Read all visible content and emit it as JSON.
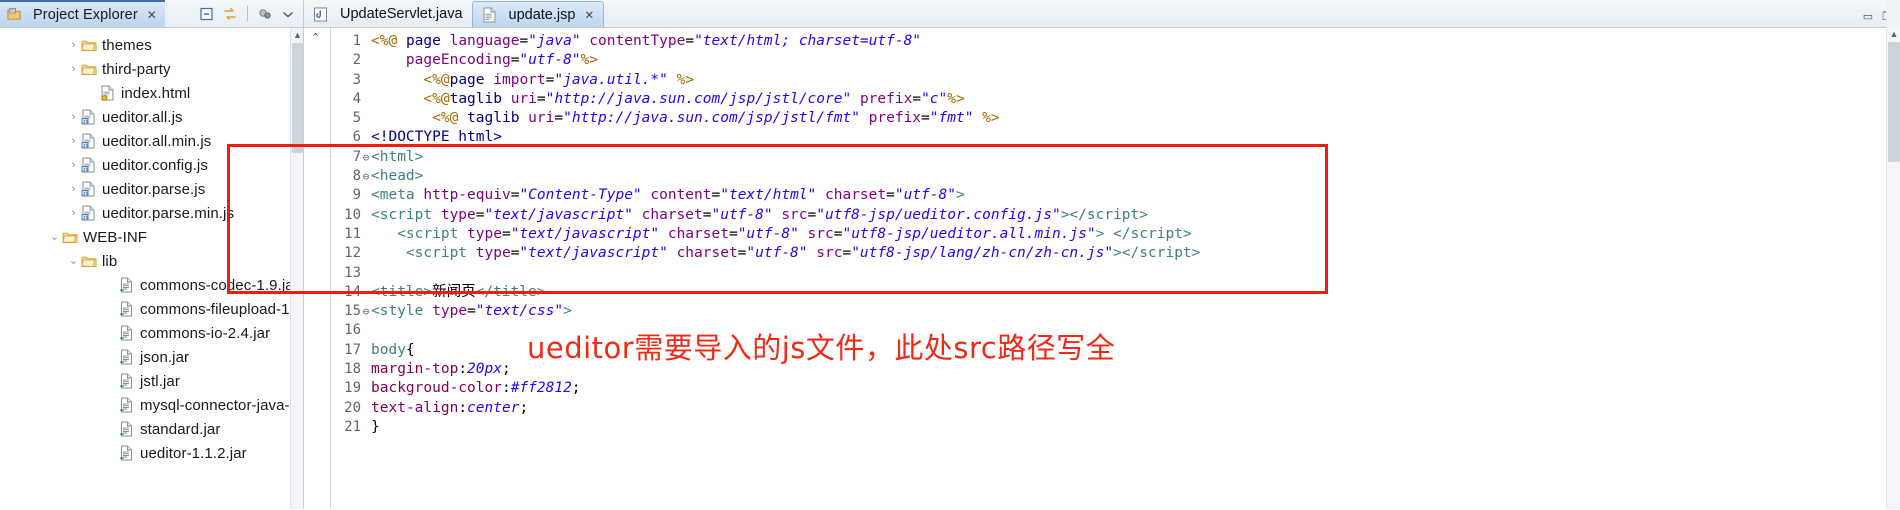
{
  "explorer": {
    "tab_title": "Project Explorer",
    "close_glyph": "✕",
    "toolbar": [
      {
        "name": "collapse-all-icon",
        "glyph": "▣"
      },
      {
        "name": "link-with-editor-icon",
        "glyph": "⇆"
      },
      {
        "name": "focus-on-active-task-icon",
        "glyph": "◕"
      },
      {
        "name": "view-menu-icon",
        "glyph": "▽"
      }
    ],
    "tree": [
      {
        "arrow": "›",
        "icon": "folder-icon",
        "label": "themes",
        "indent": 1
      },
      {
        "arrow": "›",
        "icon": "folder-icon",
        "label": "third-party",
        "indent": 1
      },
      {
        "arrow": "",
        "icon": "html-file-icon",
        "label": "index.html",
        "indent": 2
      },
      {
        "arrow": "›",
        "icon": "js-file-icon",
        "label": "ueditor.all.js",
        "indent": 1
      },
      {
        "arrow": "›",
        "icon": "js-file-icon",
        "label": "ueditor.all.min.js",
        "indent": 1
      },
      {
        "arrow": "›",
        "icon": "js-file-icon",
        "label": "ueditor.config.js",
        "indent": 1
      },
      {
        "arrow": "›",
        "icon": "js-file-icon",
        "label": "ueditor.parse.js",
        "indent": 1
      },
      {
        "arrow": "›",
        "icon": "js-file-icon",
        "label": "ueditor.parse.min.js",
        "indent": 1
      },
      {
        "arrow": "⌄",
        "icon": "folder-icon",
        "label": "WEB-INF",
        "indent": 0
      },
      {
        "arrow": "⌄",
        "icon": "folder-icon",
        "label": "lib",
        "indent": 1
      },
      {
        "arrow": "",
        "icon": "jar-file-icon",
        "label": "commons-codec-1.9.ja",
        "indent": 3
      },
      {
        "arrow": "",
        "icon": "jar-file-icon",
        "label": "commons-fileupload-1",
        "indent": 3
      },
      {
        "arrow": "",
        "icon": "jar-file-icon",
        "label": "commons-io-2.4.jar",
        "indent": 3
      },
      {
        "arrow": "",
        "icon": "jar-file-icon",
        "label": "json.jar",
        "indent": 3
      },
      {
        "arrow": "",
        "icon": "jar-file-icon",
        "label": "jstl.jar",
        "indent": 3
      },
      {
        "arrow": "",
        "icon": "jar-file-icon",
        "label": "mysql-connector-java-",
        "indent": 3
      },
      {
        "arrow": "",
        "icon": "jar-file-icon",
        "label": "standard.jar",
        "indent": 3
      },
      {
        "arrow": "",
        "icon": "jar-file-icon",
        "label": "ueditor-1.1.2.jar",
        "indent": 3
      }
    ]
  },
  "editor": {
    "tabs": [
      {
        "label": "UpdateServlet.java",
        "icon": "java-file-icon",
        "active": false,
        "closable": false
      },
      {
        "label": "update.jsp",
        "icon": "jsp-file-icon",
        "active": true,
        "closable": true
      }
    ],
    "close_glyph": "✕",
    "window_controls": [
      {
        "name": "minimize-view-icon",
        "glyph": "▭"
      },
      {
        "name": "maximize-view-icon",
        "glyph": "❐"
      }
    ],
    "explorer_window_controls": [
      {
        "name": "minimize-explorer-icon",
        "glyph": "▭"
      },
      {
        "name": "maximize-explorer-icon",
        "glyph": "❐"
      }
    ],
    "scroll_up_glyph": "⌃",
    "lines": [
      {
        "n": 1,
        "fold": "",
        "html": "<span class=\"s-dir\">&lt;%@</span> <span class=\"s-tagk\">page</span> <span class=\"s-attr\">language</span><span class=\"s-plain\">=</span><span class=\"s-str\">\"java\"</span> <span class=\"s-attr\">contentType</span><span class=\"s-plain\">=</span><span class=\"s-str\">\"text/html; charset=utf-8\"</span>"
      },
      {
        "n": 2,
        "fold": "",
        "html": "    <span class=\"s-attr\">pageEncoding</span><span class=\"s-plain\">=</span><span class=\"s-str\">\"utf-8\"</span><span class=\"s-dir\">%&gt;</span>"
      },
      {
        "n": 3,
        "fold": "",
        "html": "      <span class=\"s-dir\">&lt;%@</span><span class=\"s-tagk\">page</span> <span class=\"s-attr\">import</span><span class=\"s-plain\">=</span><span class=\"s-str\">\"java.util.*\"</span> <span class=\"s-dir\">%&gt;</span>"
      },
      {
        "n": 4,
        "fold": "",
        "html": "      <span class=\"s-dir\">&lt;%@</span><span class=\"s-tagk\">taglib</span> <span class=\"s-attr\">uri</span><span class=\"s-plain\">=</span><span class=\"s-str\">\"http://java.sun.com/jsp/jstl/core\"</span> <span class=\"s-attr\">prefix</span><span class=\"s-plain\">=</span><span class=\"s-str\">\"c\"</span><span class=\"s-dir\">%&gt;</span>"
      },
      {
        "n": 5,
        "fold": "",
        "html": "       <span class=\"s-dir\">&lt;%@</span> <span class=\"s-tagk\">taglib</span> <span class=\"s-attr\">uri</span><span class=\"s-plain\">=</span><span class=\"s-str\">\"http://java.sun.com/jsp/jstl/fmt\"</span> <span class=\"s-attr\">prefix</span><span class=\"s-plain\">=</span><span class=\"s-str\">\"fmt\"</span> <span class=\"s-dir\">%&gt;</span>"
      },
      {
        "n": 6,
        "fold": "",
        "html": "<span class=\"s-doctype\">&lt;!DOCTYPE html&gt;</span>"
      },
      {
        "n": 7,
        "fold": "⊖",
        "html": "<span class=\"s-tag\">&lt;html&gt;</span>"
      },
      {
        "n": 8,
        "fold": "⊖",
        "html": "<span class=\"s-tag\">&lt;head&gt;</span>"
      },
      {
        "n": 9,
        "fold": "",
        "html": "<span class=\"s-tag\">&lt;meta</span> <span class=\"s-attr\">http-equiv</span><span class=\"s-plain\">=</span><span class=\"s-str\">\"Content-Type\"</span> <span class=\"s-attr\">content</span><span class=\"s-plain\">=</span><span class=\"s-str\">\"text/html\"</span> <span class=\"s-attr\">charset</span><span class=\"s-plain\">=</span><span class=\"s-str\">\"utf-8\"</span><span class=\"s-tag\">&gt;</span>"
      },
      {
        "n": 10,
        "fold": "",
        "html": "<span class=\"s-tag\">&lt;script</span> <span class=\"s-attr\">type</span><span class=\"s-plain\">=</span><span class=\"s-str\">\"text/javascript\"</span> <span class=\"s-attr\">charset</span><span class=\"s-plain\">=</span><span class=\"s-str\">\"utf-8\"</span> <span class=\"s-attr\">src</span><span class=\"s-plain\">=</span><span class=\"s-str\">\"utf8-jsp/ueditor.config.js\"</span><span class=\"s-tag\">&gt;&lt;/script&gt;</span>"
      },
      {
        "n": 11,
        "fold": "",
        "html": "   <span class=\"s-tag\">&lt;script</span> <span class=\"s-attr\">type</span><span class=\"s-plain\">=</span><span class=\"s-str\">\"text/javascript\"</span> <span class=\"s-attr\">charset</span><span class=\"s-plain\">=</span><span class=\"s-str\">\"utf-8\"</span> <span class=\"s-attr\">src</span><span class=\"s-plain\">=</span><span class=\"s-str\">\"utf8-jsp/ueditor.all.min.js\"</span><span class=\"s-tag\">&gt;</span> <span class=\"s-tag\">&lt;/script&gt;</span>"
      },
      {
        "n": 12,
        "fold": "",
        "html": "    <span class=\"s-tag\">&lt;script</span> <span class=\"s-attr\">type</span><span class=\"s-plain\">=</span><span class=\"s-str\">\"text/javascript\"</span> <span class=\"s-attr\">charset</span><span class=\"s-plain\">=</span><span class=\"s-str\">\"utf-8\"</span> <span class=\"s-attr\">src</span><span class=\"s-plain\">=</span><span class=\"s-str\">\"utf8-jsp/lang/zh-cn/zh-cn.js\"</span><span class=\"s-tag\">&gt;&lt;/script&gt;</span>"
      },
      {
        "n": 13,
        "fold": "",
        "html": ""
      },
      {
        "n": 14,
        "fold": "",
        "html": "<span class=\"s-tag\">&lt;title&gt;</span><span class=\"s-cn\">新闻页</span><span class=\"s-tag\">&lt;/title&gt;</span>"
      },
      {
        "n": 15,
        "fold": "⊖",
        "html": "<span class=\"s-tag\">&lt;style</span> <span class=\"s-attr\">type</span><span class=\"s-plain\">=</span><span class=\"s-str\">\"text/css\"</span><span class=\"s-tag\">&gt;</span>"
      },
      {
        "n": 16,
        "fold": "",
        "html": ""
      },
      {
        "n": 17,
        "fold": "",
        "html": "<span class=\"s-css-sel\">body</span><span class=\"s-plain\">{</span>"
      },
      {
        "n": 18,
        "fold": "",
        "html": "<span class=\"s-css-p\">margin-top</span><span class=\"s-plain\">:</span><span class=\"s-css-v\">20px</span><span class=\"s-plain\">;</span>"
      },
      {
        "n": 19,
        "fold": "",
        "html": "<span class=\"s-css-p\">backgroud-color</span><span class=\"s-plain\">:</span><span class=\"s-css-v\">#ff2812</span><span class=\"s-plain\">;</span>"
      },
      {
        "n": 20,
        "fold": "",
        "html": "<span class=\"s-css-p\">text-align</span><span class=\"s-plain\">:</span><span class=\"s-css-v\">center</span><span class=\"s-plain\">;</span>"
      },
      {
        "n": 21,
        "fold": "",
        "html": "<span class=\"s-plain\">}</span>"
      }
    ]
  },
  "annotations": {
    "box_color": "#ee1c11",
    "note_color": "#ef2b18",
    "note_text": "ueditor需要导入的js文件，此处src路径写全"
  }
}
